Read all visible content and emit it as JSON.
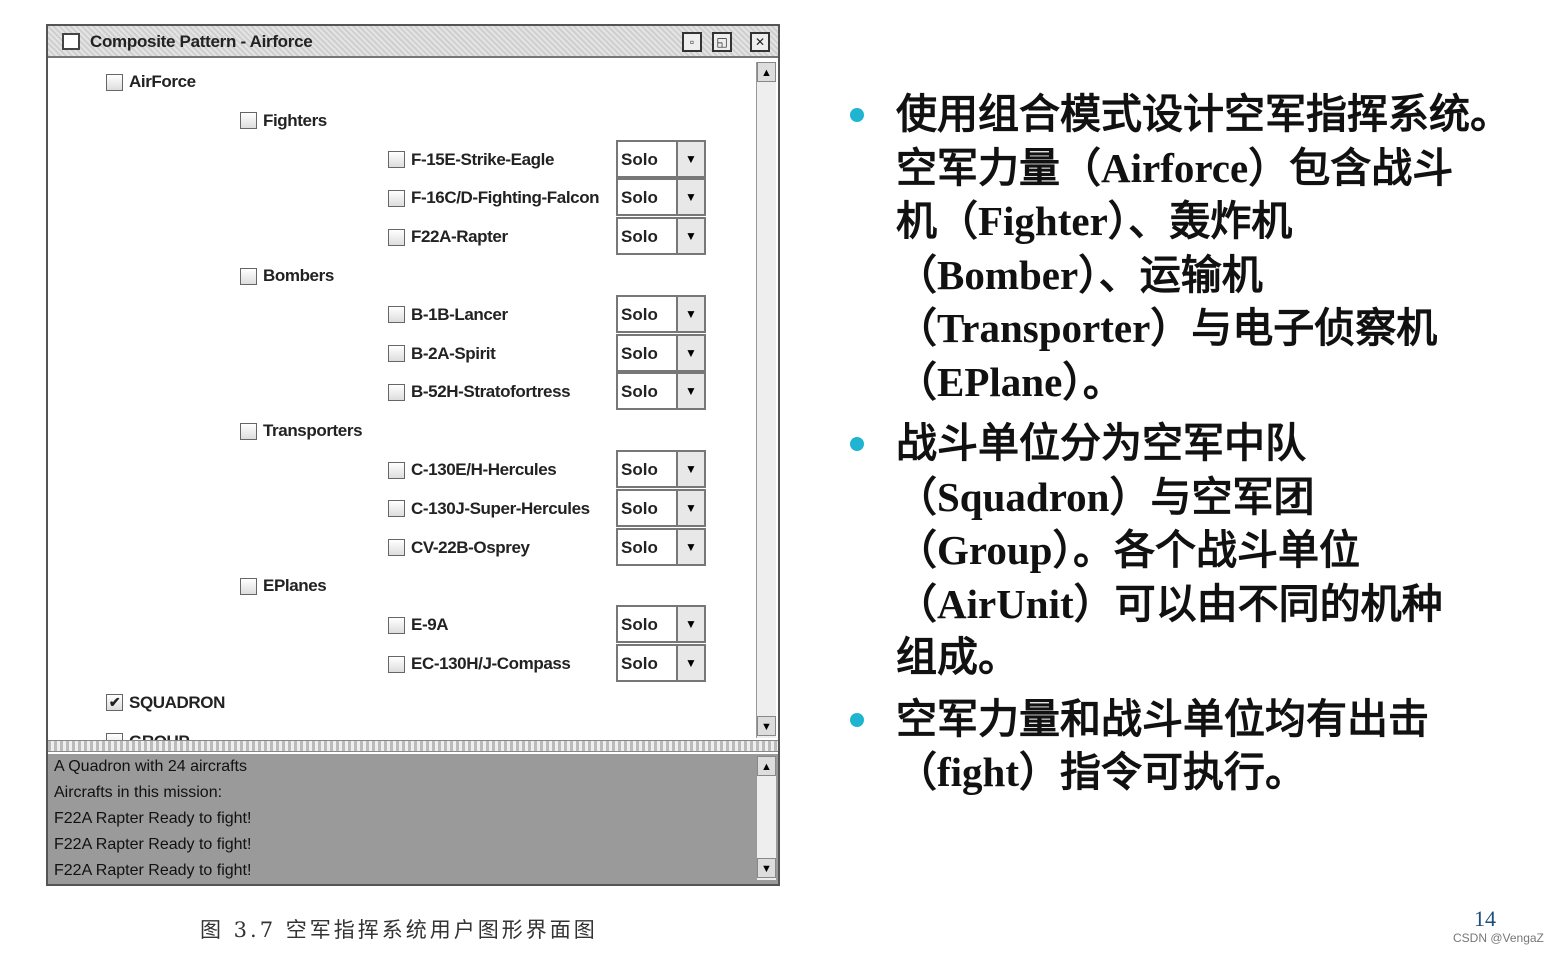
{
  "window": {
    "title": "Composite Pattern - Airforce",
    "buttons": [
      "iconify",
      "maximize",
      "close"
    ]
  },
  "tree": [
    {
      "label": "AirForce",
      "level": 0,
      "checked": false
    },
    {
      "label": "Fighters",
      "level": 1,
      "checked": false
    },
    {
      "label": "F-15E-Strike-Eagle",
      "level": 2,
      "checked": false,
      "mode": "Solo"
    },
    {
      "label": "F-16C/D-Fighting-Falcon",
      "level": 2,
      "checked": false,
      "mode": "Solo"
    },
    {
      "label": "F22A-Rapter",
      "level": 2,
      "checked": false,
      "mode": "Solo"
    },
    {
      "label": "Bombers",
      "level": 1,
      "checked": false
    },
    {
      "label": "B-1B-Lancer",
      "level": 2,
      "checked": false,
      "mode": "Solo"
    },
    {
      "label": "B-2A-Spirit",
      "level": 2,
      "checked": false,
      "mode": "Solo"
    },
    {
      "label": "B-52H-Stratofortress",
      "level": 2,
      "checked": false,
      "mode": "Solo"
    },
    {
      "label": "Transporters",
      "level": 1,
      "checked": false
    },
    {
      "label": "C-130E/H-Hercules",
      "level": 2,
      "checked": false,
      "mode": "Solo"
    },
    {
      "label": "C-130J-Super-Hercules",
      "level": 2,
      "checked": false,
      "mode": "Solo"
    },
    {
      "label": "CV-22B-Osprey",
      "level": 2,
      "checked": false,
      "mode": "Solo"
    },
    {
      "label": "EPlanes",
      "level": 1,
      "checked": false
    },
    {
      "label": "E-9A",
      "level": 2,
      "checked": false,
      "mode": "Solo"
    },
    {
      "label": "EC-130H/J-Compass",
      "level": 2,
      "checked": false,
      "mode": "Solo"
    },
    {
      "label": "SQUADRON",
      "level": 0,
      "checked": true
    },
    {
      "label": "GROUP",
      "level": 0,
      "checked": false
    }
  ],
  "output": [
    "A Quadron with 24 aircrafts",
    "Aircrafts in this mission:",
    "F22A Rapter Ready to fight!",
    "F22A Rapter Ready to fight!",
    "F22A Rapter Ready to fight!"
  ],
  "caption": "图 3.7   空军指挥系统用户图形界面图",
  "bullets": [
    {
      "lines": [
        "使用组合模式设计空军指挥系统。",
        "空军力量（Airforce）包含战斗",
        "机（Fighter）、轰炸机",
        "（Bomber）、运输机",
        "（Transporter）与电子侦察机",
        "（EPlane）。"
      ]
    },
    {
      "lines": [
        "战斗单位分为空军中队",
        "（Squadron）与空军团",
        "（Group）。各个战斗单位",
        "（AirUnit）可以由不同的机种",
        "组成。"
      ]
    },
    {
      "lines": [
        "空军力量和战斗单位均有出击",
        "（fight）指令可执行。"
      ]
    }
  ],
  "bullet_color": "#1fb4d0",
  "page_number": "14",
  "watermark": "CSDN @VengaZ"
}
